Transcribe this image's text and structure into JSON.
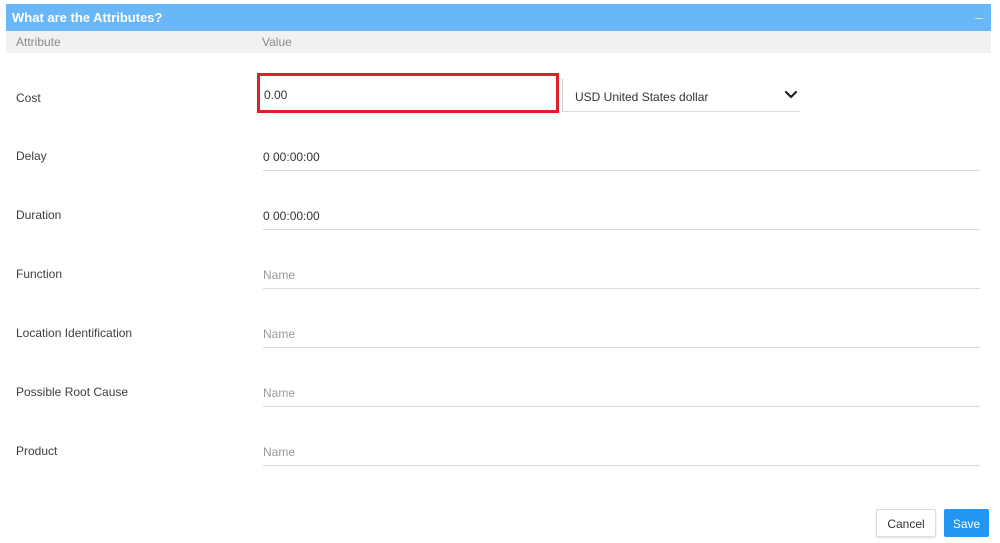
{
  "panel": {
    "title": "What are the Attributes?",
    "collapse_symbol": "–"
  },
  "columns": {
    "attribute": "Attribute",
    "value": "Value"
  },
  "rows": {
    "cost": {
      "label": "Cost",
      "value": "0.00"
    },
    "delay": {
      "label": "Delay",
      "value": "0 00:00:00"
    },
    "duration": {
      "label": "Duration",
      "value": "0 00:00:00"
    },
    "function": {
      "label": "Function",
      "placeholder": "Name"
    },
    "location": {
      "label": "Location Identification",
      "placeholder": "Name"
    },
    "root_cause": {
      "label": "Possible Root Cause",
      "placeholder": "Name"
    },
    "product": {
      "label": "Product",
      "placeholder": "Name"
    }
  },
  "currency": {
    "selected": "USD United States dollar",
    "icon": "chevron-down-icon"
  },
  "buttons": {
    "cancel": "Cancel",
    "save": "Save"
  },
  "colors": {
    "header": "#6ab7f7",
    "highlight": "#e3202a",
    "primary": "#2196f3"
  }
}
